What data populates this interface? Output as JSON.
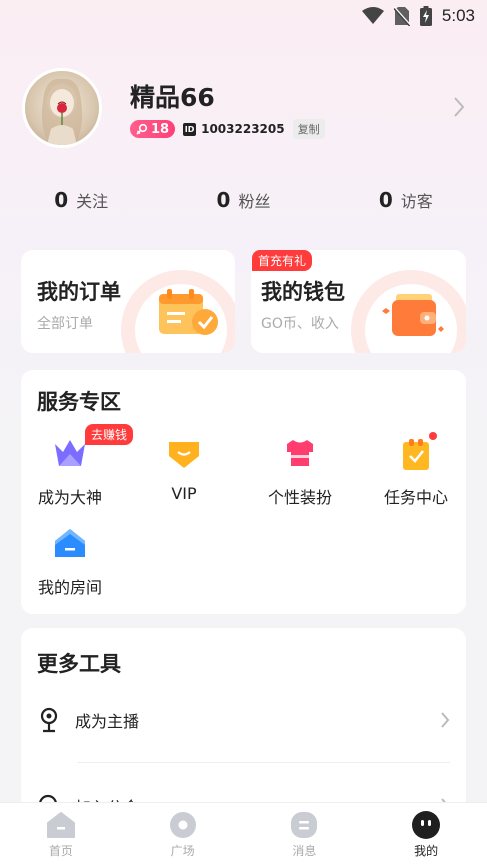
{
  "status_bar": {
    "time": "5:03"
  },
  "profile": {
    "username": "精品66",
    "gender_level": "18",
    "id_icon_text": "ID",
    "user_id": "1003223205",
    "copy_label": "复制"
  },
  "stats": [
    {
      "count": "0",
      "label": "关注"
    },
    {
      "count": "0",
      "label": "粉丝"
    },
    {
      "count": "0",
      "label": "访客"
    }
  ],
  "orders": {
    "title": "我的订单",
    "subtitle": "全部订单"
  },
  "wallet": {
    "title": "我的钱包",
    "subtitle": "GO币、收入",
    "badge": "首充有礼"
  },
  "services": {
    "title": "服务专区",
    "items": [
      {
        "label": "成为大神",
        "icon": "crown-icon",
        "badge": "去赚钱"
      },
      {
        "label": "VIP",
        "icon": "vip-diamond-icon"
      },
      {
        "label": "个性装扮",
        "icon": "shirt-icon"
      },
      {
        "label": "任务中心",
        "icon": "task-clipboard-icon"
      },
      {
        "label": "我的房间",
        "icon": "house-icon"
      }
    ]
  },
  "tools": {
    "title": "更多工具",
    "items": [
      {
        "label": "成为主播",
        "icon": "microphone-icon"
      },
      {
        "label": "加入公会",
        "icon": "search-icon"
      }
    ]
  },
  "bottom_nav": [
    {
      "label": "首页",
      "icon": "home-icon"
    },
    {
      "label": "广场",
      "icon": "plaza-icon"
    },
    {
      "label": "消息",
      "icon": "message-icon"
    },
    {
      "label": "我的",
      "icon": "profile-face-icon",
      "active": true
    }
  ],
  "colors": {
    "accent_pink": "#ff4f84",
    "badge_red": "#ff3b3b",
    "orange": "#ffa93a"
  }
}
